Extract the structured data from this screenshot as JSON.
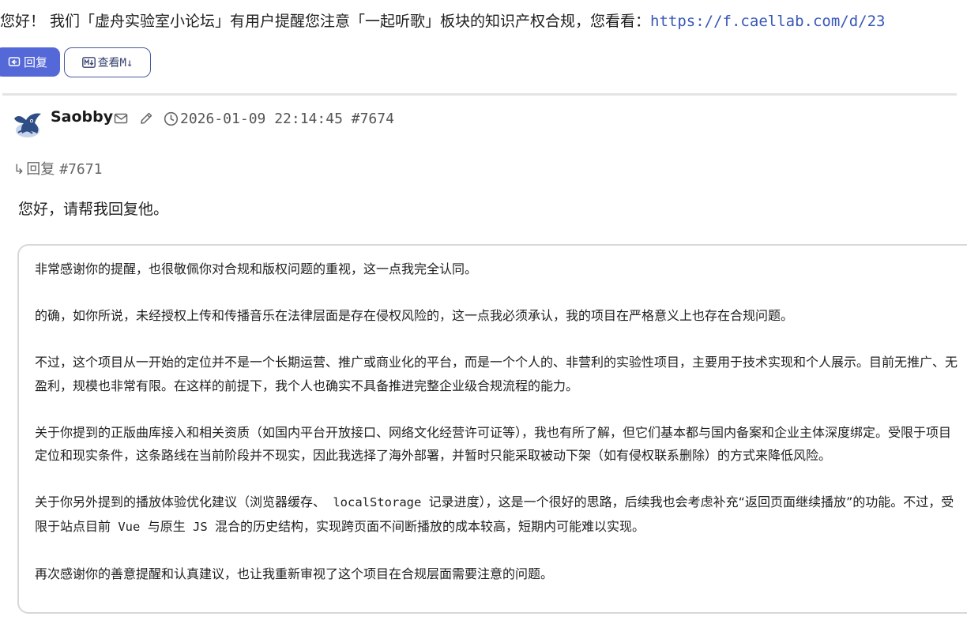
{
  "header": {
    "notice_text": "您好！  我们「虚舟实验室小论坛」有用户提醒您注意「一起听歌」板块的知识产权合规，您看看：",
    "notice_link": "https://f.caellab.com/d/23"
  },
  "actions": {
    "reply_label": "回复",
    "view_md_label": "查看M↓"
  },
  "post": {
    "author": "Saobby",
    "timestamp": "2026-01-09 22:14:45",
    "post_id": "#7674",
    "reply_to_label": "回复",
    "reply_to_id": "#7671",
    "greeting": "您好，请帮我回复他。",
    "quote": {
      "p1": "非常感谢你的提醒，也很敬佩你对合规和版权问题的重视，这一点我完全认同。",
      "p2": "的确，如你所说，未经授权上传和传播音乐在法律层面是存在侵权风险的，这一点我必须承认，我的项目在严格意义上也存在合规问题。",
      "p3": "不过，这个项目从一开始的定位并不是一个长期运营、推广或商业化的平台，而是一个个人的、非营利的实验性项目，主要用于技术实现和个人展示。目前无推广、无盈利，规模也非常有限。在这样的前提下，我个人也确实不具备推进完整企业级合规流程的能力。",
      "p4": "关于你提到的正版曲库接入和相关资质（如国内平台开放接口、网络文化经营许可证等），我也有所了解，但它们基本都与国内备案和企业主体深度绑定。受限于项目定位和现实条件，这条路线在当前阶段并不现实，因此我选择了海外部署，并暂时只能采取被动下架（如有侵权联系删除）的方式来降低风险。",
      "p5_a": "关于你另外提到的播放体验优化建议（浏览器缓存、",
      "p5_code1": " localStorage ",
      "p5_b": "记录进度），这是一个很好的思路，后续我也会考虑补充“返回页面继续播放”的功能。不过，受限于站点目前",
      "p5_code2": " Vue ",
      "p5_c": "与原生",
      "p5_code3": " JS ",
      "p5_d": "混合的历史结构，实现跨页面不间断播放的成本较高，短期内可能难以实现。",
      "p6": "再次感谢你的善意提醒和认真建议，也让我重新审视了这个项目在合规层面需要注意的问题。"
    }
  },
  "colors": {
    "accent": "#5468d8",
    "link": "#3858b8"
  },
  "icons": [
    "reply-icon",
    "markdown-icon",
    "mail-icon",
    "edit-icon",
    "clock-icon",
    "reply-arrow-icon"
  ]
}
